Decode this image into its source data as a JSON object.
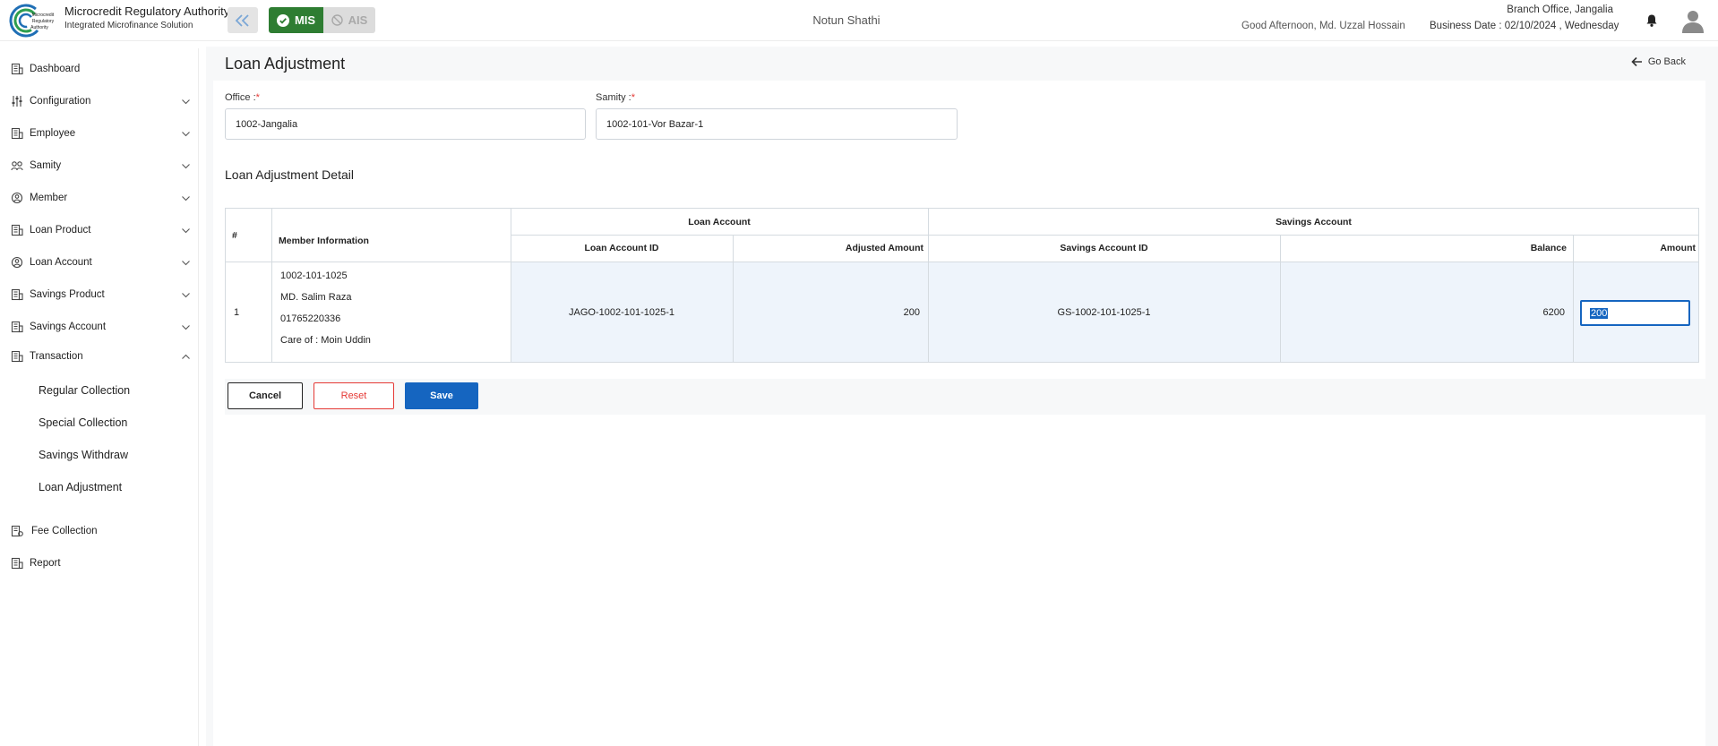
{
  "header": {
    "brand_title": "Microcredit Regulatory Authority",
    "brand_subtitle": "Integrated Microfinance Solution",
    "logo_text": "Microcredit Regulatory Authority",
    "mode_mis": "MIS",
    "mode_ais": "AIS",
    "org_name": "Notun Shathi",
    "greeting": "Good Afternoon, Md. Uzzal Hossain",
    "branch_office": "Branch Office, Jangalia",
    "business_date": "Business Date : 02/10/2024 , Wednesday"
  },
  "sidebar": {
    "items": [
      {
        "label": "Dashboard",
        "icon": "building-icon",
        "expandable": false
      },
      {
        "label": "Configuration",
        "icon": "sliders-icon",
        "expandable": true
      },
      {
        "label": "Employee",
        "icon": "building-icon",
        "expandable": true
      },
      {
        "label": "Samity",
        "icon": "group-icon",
        "expandable": true
      },
      {
        "label": "Member",
        "icon": "users-icon",
        "expandable": true
      },
      {
        "label": "Loan Product",
        "icon": "building-icon",
        "expandable": true
      },
      {
        "label": "Loan Account",
        "icon": "users-icon",
        "expandable": true
      },
      {
        "label": "Savings Product",
        "icon": "building-icon",
        "expandable": true
      },
      {
        "label": "Savings Account",
        "icon": "building-icon",
        "expandable": true
      },
      {
        "label": "Transaction",
        "icon": "building-icon",
        "expandable": true,
        "expanded": true
      }
    ],
    "transaction_sub": [
      "Regular Collection",
      "Special Collection",
      "Savings Withdraw",
      "Loan Adjustment"
    ],
    "bottom_items": [
      {
        "label": "Fee Collection",
        "icon": "fee-icon"
      },
      {
        "label": "Report",
        "icon": "building-icon"
      }
    ]
  },
  "page": {
    "title": "Loan Adjustment",
    "go_back": "Go Back",
    "office_label": "Office :",
    "office_value": "1002-Jangalia",
    "samity_label": "Samity :",
    "samity_value": "1002-101-Vor Bazar-1",
    "required_mark": "*",
    "section_title": "Loan Adjustment Detail"
  },
  "table": {
    "headers": {
      "index": "#",
      "member_info": "Member Information",
      "loan_account": "Loan Account",
      "savings_account": "Savings Account",
      "loan_account_id": "Loan Account ID",
      "adjusted_amount": "Adjusted Amount",
      "savings_account_id": "Savings Account ID",
      "balance": "Balance",
      "amount": "Amount"
    },
    "rows": [
      {
        "index": "1",
        "member_id": "1002-101-1025",
        "member_name": "MD. Salim Raza",
        "phone": "01765220336",
        "care_of": "Care of : Moin Uddin",
        "loan_account_id": "JAGO-1002-101-1025-1",
        "adjusted_amount": "200",
        "savings_account_id": "GS-1002-101-1025-1",
        "balance": "6200",
        "amount": "200"
      }
    ]
  },
  "buttons": {
    "cancel": "Cancel",
    "reset": "Reset",
    "save": "Save"
  },
  "colors": {
    "mis_green": "#2e7d32",
    "primary_blue": "#1565c0",
    "danger_red": "#e53935"
  }
}
